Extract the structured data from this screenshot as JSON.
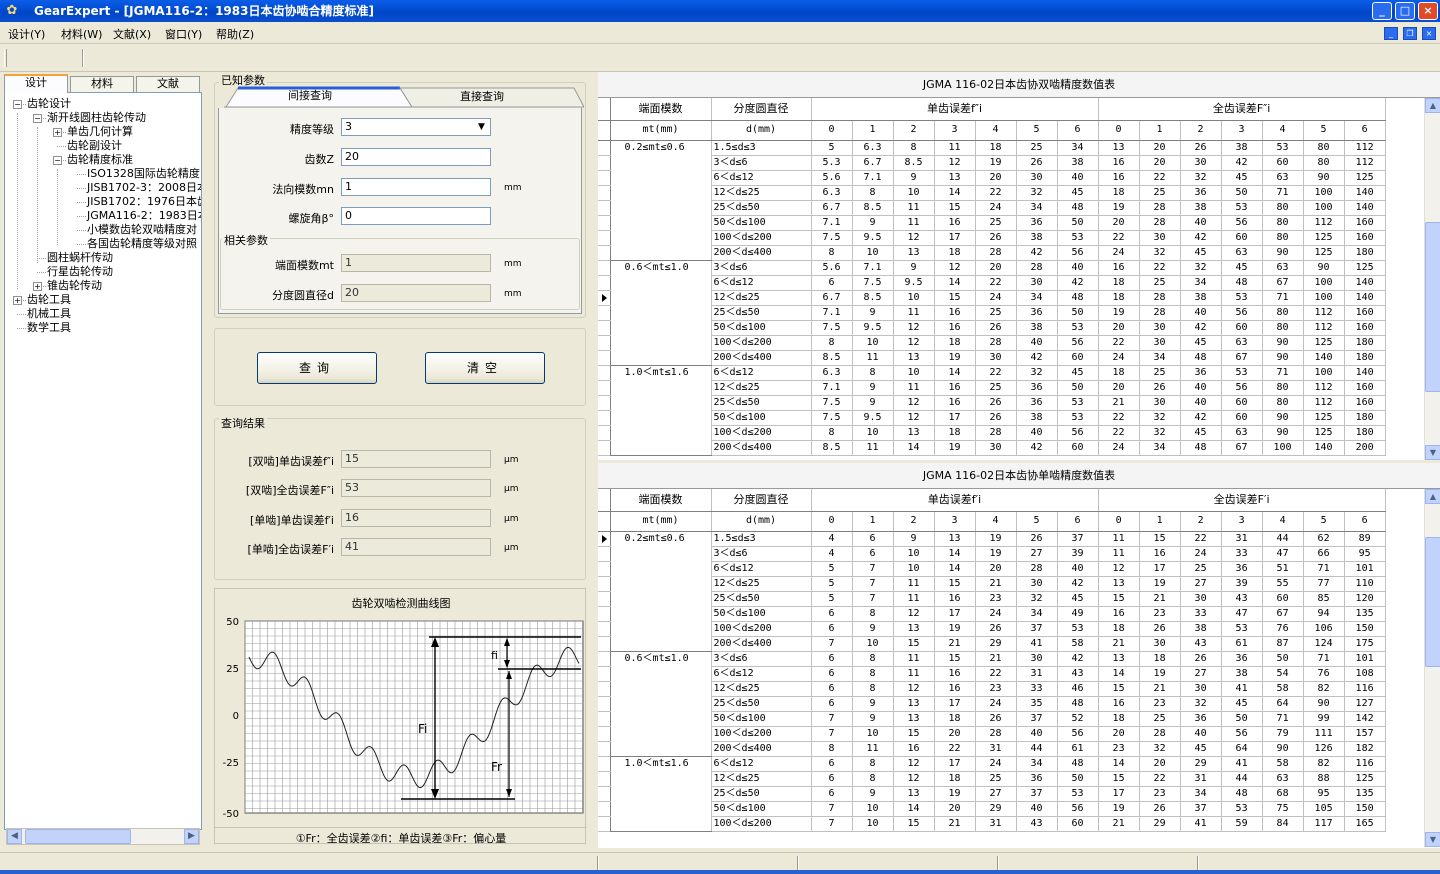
{
  "window": {
    "title": "GearExpert - [JGMA116-2：1983日本齿协啮合精度标准]",
    "icon": "gear-app-icon",
    "minimize": "_",
    "maximize": "□",
    "close": "×"
  },
  "menu": [
    "设计(Y)",
    "材料(W)",
    "文献(X)",
    "窗口(Y)",
    "帮助(Z)"
  ],
  "left_tabs": [
    "设计",
    "材料",
    "文献"
  ],
  "tree": [
    {
      "label": "齿轮设计",
      "level": 0,
      "toggle": "−"
    },
    {
      "label": "渐开线圆柱齿轮传动",
      "level": 1,
      "toggle": "−"
    },
    {
      "label": "单齿几何计算",
      "level": 2,
      "toggle": "+"
    },
    {
      "label": "齿轮副设计",
      "level": 2,
      "toggle": ""
    },
    {
      "label": "齿轮精度标准",
      "level": 2,
      "toggle": "−"
    },
    {
      "label": "ISO1328国际齿轮精度",
      "level": 3,
      "toggle": ""
    },
    {
      "label": "JISB1702-3：2008日本",
      "level": 3,
      "toggle": ""
    },
    {
      "label": "JISB1702：1976日本齿",
      "level": 3,
      "toggle": ""
    },
    {
      "label": "JGMA116-2：1983日本",
      "level": 3,
      "toggle": ""
    },
    {
      "label": "小模数齿轮双啮精度对",
      "level": 3,
      "toggle": ""
    },
    {
      "label": "各国齿轮精度等级对照",
      "level": 3,
      "toggle": ""
    },
    {
      "label": "圆柱蜗杆传动",
      "level": 1,
      "toggle": ""
    },
    {
      "label": "行星齿轮传动",
      "level": 1,
      "toggle": ""
    },
    {
      "label": "锥齿轮传动",
      "level": 1,
      "toggle": "+"
    },
    {
      "label": "齿轮工具",
      "level": 0,
      "toggle": "+"
    },
    {
      "label": "机械工具",
      "level": 0,
      "toggle": ""
    },
    {
      "label": "数学工具",
      "level": 0,
      "toggle": ""
    }
  ],
  "known_params": {
    "group_label": "已知参数",
    "tabs": [
      "间接查询",
      "直接查询"
    ],
    "fields": [
      {
        "label": "精度等级",
        "value": "3",
        "unit": ""
      },
      {
        "label": "齿数Z",
        "value": "20",
        "unit": ""
      },
      {
        "label": "法向模数mn",
        "value": "1",
        "unit": "mm"
      },
      {
        "label": "螺旋角β°",
        "value": "0",
        "unit": ""
      }
    ],
    "related_label": "相关参数",
    "related": [
      {
        "label": "端面模数mt",
        "value": "1",
        "unit": "mm"
      },
      {
        "label": "分度圆直径d",
        "value": "20",
        "unit": "mm"
      }
    ]
  },
  "buttons": {
    "query": "查询",
    "clear": "清空"
  },
  "results": {
    "group_label": "查询结果",
    "fields": [
      {
        "label": "[双啮]单齿误差f″i",
        "value": "15",
        "unit": "μm"
      },
      {
        "label": "[双啮]全齿误差F″i",
        "value": "53",
        "unit": "μm"
      },
      {
        "label": "[单啮]单齿误差f′i",
        "value": "16",
        "unit": "μm"
      },
      {
        "label": "[单啮]全齿误差F′i",
        "value": "41",
        "unit": "μm"
      }
    ]
  },
  "chart": {
    "title": "齿轮双啮检测曲线图",
    "y_ticks": [
      "50",
      "25",
      "0",
      "-25",
      "-50"
    ],
    "labels": {
      "fi": "fi",
      "Fi": "Fi",
      "Fr": "Fr"
    },
    "caption": "①Fr：全齿误差②fi：单齿误差③Fr：偏心量"
  },
  "table1": {
    "title": "JGMA 116-02日本齿协双啮精度数值表",
    "head": {
      "col1": "端面模数",
      "col2": "分度圆直径",
      "g1": "单齿误差f″i",
      "g2": "全齿误差F″i",
      "sub1": "mt(mm)",
      "sub2": "d(mm)",
      "grades": [
        "0",
        "1",
        "2",
        "3",
        "4",
        "5",
        "6"
      ]
    },
    "rows": [
      {
        "band": "0.2≤mt≤0.6",
        "d": "1.5≤d≤3",
        "v": [
          "5",
          "6.3",
          "8",
          "11",
          "18",
          "25",
          "34",
          "13",
          "20",
          "26",
          "38",
          "53",
          "80",
          "112"
        ]
      },
      {
        "band": "",
        "d": "3＜d≤6",
        "v": [
          "5.3",
          "6.7",
          "8.5",
          "12",
          "19",
          "26",
          "38",
          "16",
          "20",
          "30",
          "42",
          "60",
          "80",
          "112"
        ]
      },
      {
        "band": "",
        "d": "6＜d≤12",
        "v": [
          "5.6",
          "7.1",
          "9",
          "13",
          "20",
          "30",
          "40",
          "16",
          "22",
          "32",
          "45",
          "63",
          "90",
          "125"
        ]
      },
      {
        "band": "",
        "d": "12＜d≤25",
        "v": [
          "6.3",
          "8",
          "10",
          "14",
          "22",
          "32",
          "45",
          "18",
          "25",
          "36",
          "50",
          "71",
          "100",
          "140"
        ]
      },
      {
        "band": "",
        "d": "25＜d≤50",
        "v": [
          "6.7",
          "8.5",
          "11",
          "15",
          "24",
          "34",
          "48",
          "19",
          "28",
          "38",
          "53",
          "80",
          "100",
          "140"
        ]
      },
      {
        "band": "",
        "d": "50＜d≤100",
        "v": [
          "7.1",
          "9",
          "11",
          "16",
          "25",
          "36",
          "50",
          "20",
          "28",
          "40",
          "56",
          "80",
          "112",
          "160"
        ]
      },
      {
        "band": "",
        "d": "100＜d≤200",
        "v": [
          "7.5",
          "9.5",
          "12",
          "17",
          "26",
          "38",
          "53",
          "22",
          "30",
          "42",
          "60",
          "80",
          "125",
          "160"
        ]
      },
      {
        "band": "",
        "d": "200＜d≤400",
        "v": [
          "8",
          "10",
          "13",
          "18",
          "28",
          "42",
          "56",
          "24",
          "32",
          "45",
          "63",
          "90",
          "125",
          "180"
        ]
      },
      {
        "band": "0.6＜mt≤1.0",
        "d": "3＜d≤6",
        "v": [
          "5.6",
          "7.1",
          "9",
          "12",
          "20",
          "28",
          "40",
          "16",
          "22",
          "32",
          "45",
          "63",
          "90",
          "125"
        ]
      },
      {
        "band": "",
        "d": "6＜d≤12",
        "v": [
          "6",
          "7.5",
          "9.5",
          "14",
          "22",
          "30",
          "42",
          "18",
          "25",
          "34",
          "48",
          "67",
          "100",
          "140"
        ]
      },
      {
        "band": "",
        "d": "12＜d≤25",
        "v": [
          "6.7",
          "8.5",
          "10",
          "15",
          "24",
          "34",
          "48",
          "18",
          "28",
          "38",
          "53",
          "71",
          "100",
          "140"
        ],
        "selected": true
      },
      {
        "band": "",
        "d": "25＜d≤50",
        "v": [
          "7.1",
          "9",
          "11",
          "16",
          "25",
          "36",
          "50",
          "19",
          "28",
          "40",
          "56",
          "80",
          "112",
          "160"
        ]
      },
      {
        "band": "",
        "d": "50＜d≤100",
        "v": [
          "7.5",
          "9.5",
          "12",
          "16",
          "26",
          "38",
          "53",
          "20",
          "30",
          "42",
          "60",
          "80",
          "112",
          "160"
        ]
      },
      {
        "band": "",
        "d": "100＜d≤200",
        "v": [
          "8",
          "10",
          "12",
          "18",
          "28",
          "40",
          "56",
          "22",
          "30",
          "45",
          "63",
          "90",
          "125",
          "180"
        ]
      },
      {
        "band": "",
        "d": "200＜d≤400",
        "v": [
          "8.5",
          "11",
          "13",
          "19",
          "30",
          "42",
          "60",
          "24",
          "34",
          "48",
          "67",
          "90",
          "140",
          "180"
        ]
      },
      {
        "band": "1.0＜mt≤1.6",
        "d": "6＜d≤12",
        "v": [
          "6.3",
          "8",
          "10",
          "14",
          "22",
          "32",
          "45",
          "18",
          "25",
          "36",
          "53",
          "71",
          "100",
          "140"
        ]
      },
      {
        "band": "",
        "d": "12＜d≤25",
        "v": [
          "7.1",
          "9",
          "11",
          "16",
          "25",
          "36",
          "50",
          "20",
          "26",
          "40",
          "56",
          "80",
          "112",
          "160"
        ]
      },
      {
        "band": "",
        "d": "25＜d≤50",
        "v": [
          "7.5",
          "9",
          "12",
          "16",
          "26",
          "36",
          "53",
          "21",
          "30",
          "40",
          "60",
          "80",
          "112",
          "160"
        ]
      },
      {
        "band": "",
        "d": "50＜d≤100",
        "v": [
          "7.5",
          "9.5",
          "12",
          "17",
          "26",
          "38",
          "53",
          "22",
          "32",
          "42",
          "60",
          "90",
          "125",
          "180"
        ]
      },
      {
        "band": "",
        "d": "100＜d≤200",
        "v": [
          "8",
          "10",
          "13",
          "18",
          "28",
          "40",
          "56",
          "22",
          "32",
          "45",
          "63",
          "90",
          "125",
          "180"
        ]
      },
      {
        "band": "",
        "d": "200＜d≤400",
        "v": [
          "8.5",
          "11",
          "14",
          "19",
          "30",
          "42",
          "60",
          "24",
          "34",
          "48",
          "67",
          "100",
          "140",
          "200"
        ]
      }
    ]
  },
  "table2": {
    "title": "JGMA 116-02日本齿协单啮精度数值表",
    "head": {
      "col1": "端面模数",
      "col2": "分度圆直径",
      "g1": "单齿误差f′i",
      "g2": "全齿误差F′i",
      "sub1": "mt(mm)",
      "sub2": "d(mm)",
      "grades": [
        "0",
        "1",
        "2",
        "3",
        "4",
        "5",
        "6"
      ]
    },
    "rows": [
      {
        "band": "0.2≤mt≤0.6",
        "d": "1.5≤d≤3",
        "v": [
          "4",
          "6",
          "9",
          "13",
          "19",
          "26",
          "37",
          "11",
          "15",
          "22",
          "31",
          "44",
          "62",
          "89"
        ],
        "selected": true
      },
      {
        "band": "",
        "d": "3＜d≤6",
        "v": [
          "4",
          "6",
          "10",
          "14",
          "19",
          "27",
          "39",
          "11",
          "16",
          "24",
          "33",
          "47",
          "66",
          "95"
        ]
      },
      {
        "band": "",
        "d": "6＜d≤12",
        "v": [
          "5",
          "7",
          "10",
          "14",
          "20",
          "28",
          "40",
          "12",
          "17",
          "25",
          "36",
          "51",
          "71",
          "101"
        ]
      },
      {
        "band": "",
        "d": "12＜d≤25",
        "v": [
          "5",
          "7",
          "11",
          "15",
          "21",
          "30",
          "42",
          "13",
          "19",
          "27",
          "39",
          "55",
          "77",
          "110"
        ]
      },
      {
        "band": "",
        "d": "25＜d≤50",
        "v": [
          "5",
          "7",
          "11",
          "16",
          "23",
          "32",
          "45",
          "15",
          "21",
          "30",
          "43",
          "60",
          "85",
          "120"
        ]
      },
      {
        "band": "",
        "d": "50＜d≤100",
        "v": [
          "6",
          "8",
          "12",
          "17",
          "24",
          "34",
          "49",
          "16",
          "23",
          "33",
          "47",
          "67",
          "94",
          "135"
        ]
      },
      {
        "band": "",
        "d": "100＜d≤200",
        "v": [
          "6",
          "9",
          "13",
          "19",
          "26",
          "37",
          "53",
          "18",
          "26",
          "38",
          "53",
          "76",
          "106",
          "150"
        ]
      },
      {
        "band": "",
        "d": "200＜d≤400",
        "v": [
          "7",
          "10",
          "15",
          "21",
          "29",
          "41",
          "58",
          "21",
          "30",
          "43",
          "61",
          "87",
          "124",
          "175"
        ]
      },
      {
        "band": "0.6＜mt≤1.0",
        "d": "3＜d≤6",
        "v": [
          "6",
          "8",
          "11",
          "15",
          "21",
          "30",
          "42",
          "13",
          "18",
          "26",
          "36",
          "50",
          "71",
          "101"
        ]
      },
      {
        "band": "",
        "d": "6＜d≤12",
        "v": [
          "6",
          "8",
          "11",
          "16",
          "22",
          "31",
          "43",
          "14",
          "19",
          "27",
          "38",
          "54",
          "76",
          "108"
        ]
      },
      {
        "band": "",
        "d": "12＜d≤25",
        "v": [
          "6",
          "8",
          "12",
          "16",
          "23",
          "33",
          "46",
          "15",
          "21",
          "30",
          "41",
          "58",
          "82",
          "116"
        ]
      },
      {
        "band": "",
        "d": "25＜d≤50",
        "v": [
          "6",
          "9",
          "13",
          "17",
          "24",
          "35",
          "48",
          "16",
          "23",
          "32",
          "45",
          "64",
          "90",
          "127"
        ]
      },
      {
        "band": "",
        "d": "50＜d≤100",
        "v": [
          "7",
          "9",
          "13",
          "18",
          "26",
          "37",
          "52",
          "18",
          "25",
          "36",
          "50",
          "71",
          "99",
          "142"
        ]
      },
      {
        "band": "",
        "d": "100＜d≤200",
        "v": [
          "7",
          "10",
          "15",
          "20",
          "28",
          "40",
          "56",
          "20",
          "28",
          "40",
          "56",
          "79",
          "111",
          "157"
        ]
      },
      {
        "band": "",
        "d": "200＜d≤400",
        "v": [
          "8",
          "11",
          "16",
          "22",
          "31",
          "44",
          "61",
          "23",
          "32",
          "45",
          "64",
          "90",
          "126",
          "182"
        ]
      },
      {
        "band": "1.0＜mt≤1.6",
        "d": "6＜d≤12",
        "v": [
          "6",
          "8",
          "12",
          "17",
          "24",
          "34",
          "48",
          "14",
          "20",
          "29",
          "41",
          "58",
          "82",
          "116"
        ]
      },
      {
        "band": "",
        "d": "12＜d≤25",
        "v": [
          "6",
          "8",
          "12",
          "18",
          "25",
          "36",
          "50",
          "15",
          "22",
          "31",
          "44",
          "63",
          "88",
          "125"
        ]
      },
      {
        "band": "",
        "d": "25＜d≤50",
        "v": [
          "6",
          "9",
          "13",
          "19",
          "27",
          "37",
          "53",
          "17",
          "23",
          "34",
          "48",
          "68",
          "95",
          "135"
        ]
      },
      {
        "band": "",
        "d": "50＜d≤100",
        "v": [
          "7",
          "10",
          "14",
          "20",
          "29",
          "40",
          "56",
          "19",
          "26",
          "37",
          "53",
          "75",
          "105",
          "150"
        ]
      },
      {
        "band": "",
        "d": "100＜d≤200",
        "v": [
          "7",
          "10",
          "15",
          "21",
          "31",
          "43",
          "60",
          "21",
          "29",
          "41",
          "59",
          "84",
          "117",
          "165"
        ]
      }
    ]
  }
}
